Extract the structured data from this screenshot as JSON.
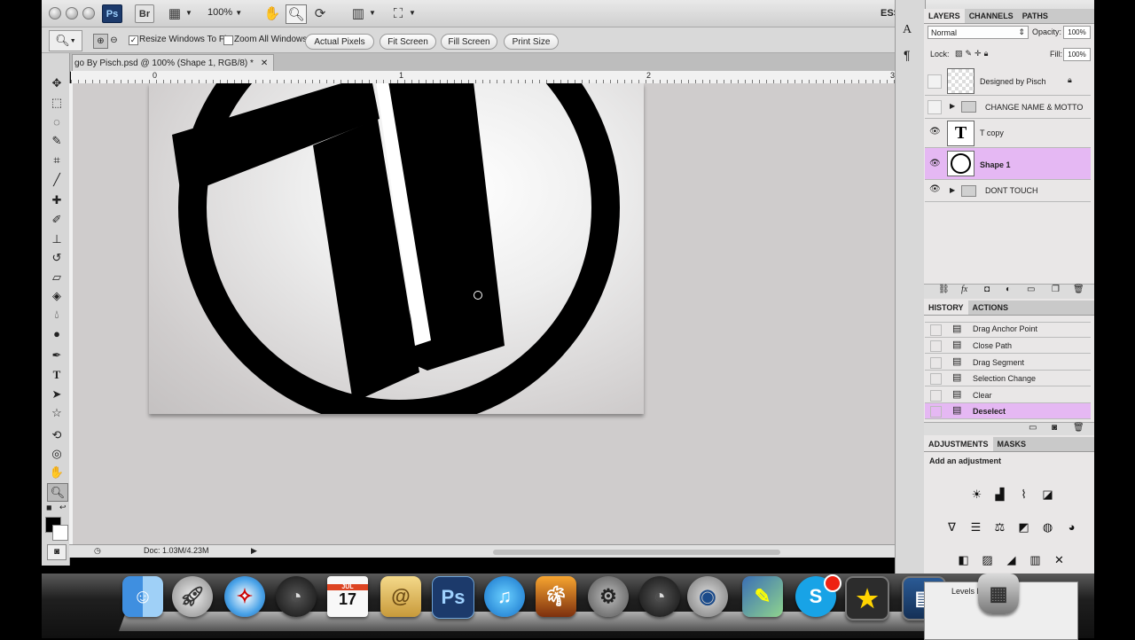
{
  "app": {
    "ps_badge": "Ps",
    "br_badge": "Br",
    "zoom_level": "100%",
    "workspace": "ESS"
  },
  "options_bar": {
    "resize_windows": "Resize Windows To Fit",
    "zoom_all": "Zoom All Windows",
    "actual_pixels": "Actual Pixels",
    "fit_screen": "Fit Screen",
    "fill_screen": "Fill Screen",
    "print_size": "Print Size"
  },
  "document": {
    "tab_title": "go By Pisch.psd @ 100% (Shape 1, RGB/8) *",
    "close": "✕",
    "ruler": [
      "0",
      "1",
      "2",
      "3"
    ],
    "status": "Doc: 1.03M/4.23M"
  },
  "layers_panel": {
    "tabs": [
      "LAYERS",
      "CHANNELS",
      "PATHS"
    ],
    "blend_mode": "Normal",
    "opacity_label": "Opacity:",
    "opacity": "100%",
    "lock_label": "Lock:",
    "fill_label": "Fill:",
    "fill": "100%",
    "layers": [
      {
        "name": "Designed by Pisch",
        "visible": false,
        "locked": true
      },
      {
        "name": "CHANGE NAME & MOTTO",
        "visible": false,
        "group": true
      },
      {
        "name": "T copy",
        "visible": true
      },
      {
        "name": "Shape 1",
        "visible": true,
        "selected": true
      },
      {
        "name": "DONT TOUCH",
        "visible": true,
        "group": true
      }
    ]
  },
  "history_panel": {
    "tabs": [
      "HISTORY",
      "ACTIONS"
    ],
    "items": [
      "Drag Anchor Point",
      "Close Path",
      "Drag Segment",
      "Selection Change",
      "Clear",
      "Deselect"
    ]
  },
  "adjustments_panel": {
    "tabs": [
      "ADJUSTMENTS",
      "MASKS"
    ],
    "hint": "Add an adjustment"
  },
  "dock": {
    "photoshop_label": "Ps",
    "calendar_month": "JUL",
    "calendar_day": "17",
    "levels_window_title": "Levels P"
  }
}
